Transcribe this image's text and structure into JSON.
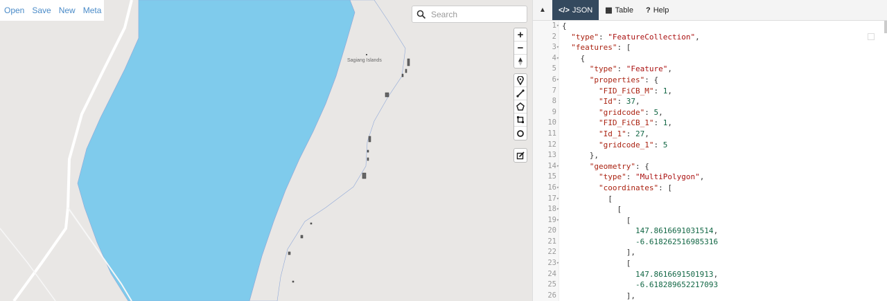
{
  "menu": {
    "open": "Open",
    "save": "Save",
    "new": "New",
    "meta": "Meta"
  },
  "search": {
    "placeholder": "Search"
  },
  "map": {
    "place_label": "Sagiang Islands",
    "water_color": "#7fcbec",
    "land_color": "#e9e7e5"
  },
  "controls": {
    "zoom": [
      {
        "name": "zoom-in",
        "glyph": "+"
      },
      {
        "name": "zoom-out",
        "glyph": "−"
      }
    ],
    "draw": [
      "marker",
      "line",
      "polygon",
      "rectangle",
      "circle"
    ],
    "edit": "edit"
  },
  "tabs": [
    {
      "icon": "</>",
      "label": "JSON",
      "active": true
    },
    {
      "icon": "▦",
      "label": "Table",
      "active": false
    },
    {
      "icon": "?",
      "label": "Help",
      "active": false
    }
  ],
  "code_lines": [
    "{",
    "  \"type\": \"FeatureCollection\",",
    "  \"features\": [",
    "    {",
    "      \"type\": \"Feature\",",
    "      \"properties\": {",
    "        \"FID_FiCB_M\": 1,",
    "        \"Id\": 37,",
    "        \"gridcode\": 5,",
    "        \"FID_FiCB_1\": 1,",
    "        \"Id_1\": 27,",
    "        \"gridcode_1\": 5",
    "      },",
    "      \"geometry\": {",
    "        \"type\": \"MultiPolygon\",",
    "        \"coordinates\": [",
    "          [",
    "            [",
    "              [",
    "                147.8616691031514,",
    "                -6.618262516985316",
    "              ],",
    "              [",
    "                147.8616691501913,",
    "                -6.618289652217093",
    "              ],"
  ],
  "fold_lines": [
    1,
    3,
    4,
    6,
    14,
    16,
    17,
    18,
    19,
    23
  ]
}
